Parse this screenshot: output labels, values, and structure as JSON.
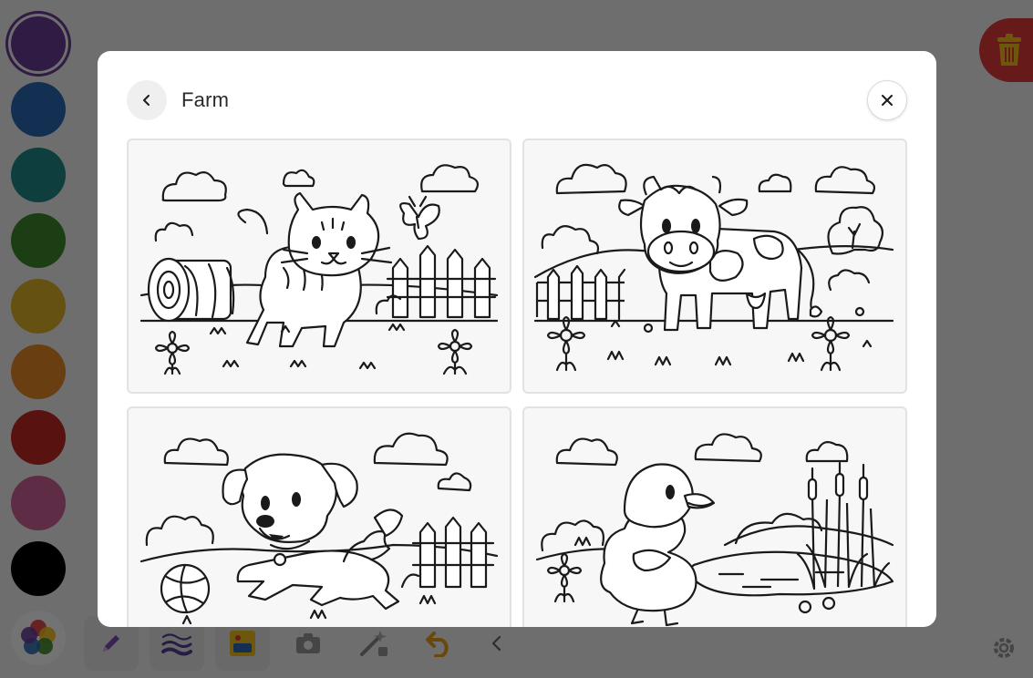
{
  "modal": {
    "title": "Farm",
    "back_icon": "chevron-left-icon",
    "close_icon": "close-icon"
  },
  "pages": [
    {
      "subject": "kitten"
    },
    {
      "subject": "cow"
    },
    {
      "subject": "puppy"
    },
    {
      "subject": "duckling"
    }
  ],
  "palette": {
    "colors": [
      "#6a3d9a",
      "#2c6bb5",
      "#1f8a8a",
      "#3f8a2e",
      "#e0b528",
      "#e88a24",
      "#c42a25",
      "#d0649a",
      "#000000"
    ],
    "selected": "#6a3d9a"
  },
  "toolbar": {
    "icons": [
      "color-wheel-icon",
      "pen-icon",
      "stroke-width-icon",
      "image-icon",
      "camera-icon",
      "magic-wand-icon",
      "undo-icon",
      "chevron-left-icon",
      "gear-icon",
      "trash-icon"
    ]
  },
  "colors": {
    "overlay": "rgba(0,0,0,0.55)",
    "trash": "#e23b3b",
    "card_border": "#e2e2e2"
  }
}
